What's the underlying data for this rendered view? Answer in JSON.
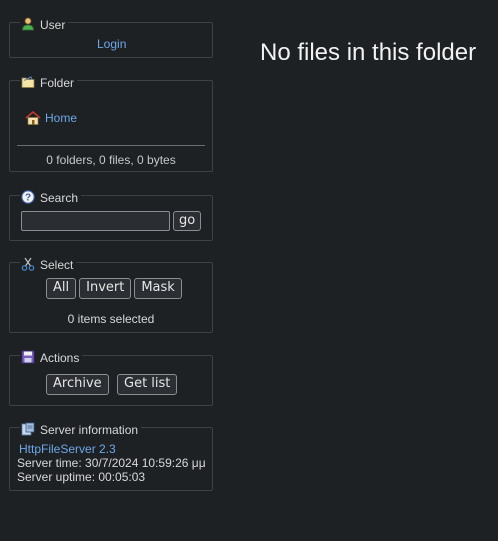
{
  "user": {
    "title": "User",
    "login_label": "Login"
  },
  "folder": {
    "title": "Folder",
    "home_label": "Home",
    "stats": "0 folders, 0 files, 0 bytes"
  },
  "search": {
    "title": "Search",
    "input_value": "",
    "go_label": "go"
  },
  "select": {
    "title": "Select",
    "all_label": "All",
    "invert_label": "Invert",
    "mask_label": "Mask",
    "status": "0 items selected"
  },
  "actions": {
    "title": "Actions",
    "archive_label": "Archive",
    "getlist_label": "Get list"
  },
  "server_info": {
    "title": "Server information",
    "server_link": "HttpFileServer 2.3",
    "server_time": "Server time: 30/7/2024 10:59:26 μμ",
    "server_uptime": "Server uptime: 00:05:03"
  },
  "main": {
    "empty_message": "No files in this folder"
  }
}
